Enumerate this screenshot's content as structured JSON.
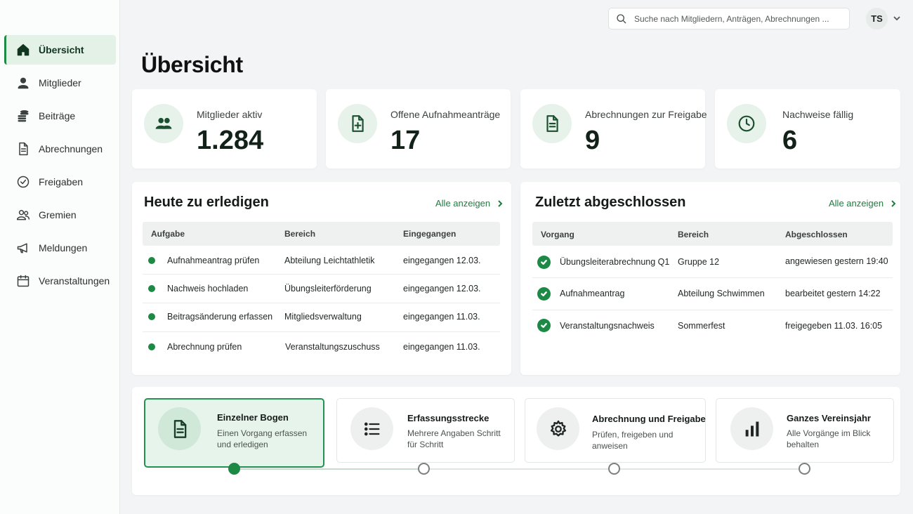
{
  "sidebar": {
    "items": [
      {
        "label": "Übersicht",
        "icon": "home-icon",
        "active": true
      },
      {
        "label": "Mitglieder",
        "icon": "person-icon"
      },
      {
        "label": "Beiträge",
        "icon": "coins-icon"
      },
      {
        "label": "Abrechnungen",
        "icon": "document-icon"
      },
      {
        "label": "Freigaben",
        "icon": "check-circle-icon"
      },
      {
        "label": "Gremien",
        "icon": "group-icon"
      },
      {
        "label": "Meldungen",
        "icon": "megaphone-icon"
      },
      {
        "label": "Veranstaltungen",
        "icon": "calendar-icon"
      }
    ]
  },
  "header": {
    "search_placeholder": "Suche nach Mitgliedern, Anträgen, Abrechnungen ...",
    "user_initials": "TS"
  },
  "page_title": "Übersicht",
  "stats": [
    {
      "label": "Mitglieder aktiv",
      "value": "1.284",
      "icon": "people-icon"
    },
    {
      "label": "Offene Aufnahmeanträge",
      "value": "17",
      "icon": "file-plus-icon"
    },
    {
      "label": "Abrechnungen zur Freigabe",
      "value": "9",
      "icon": "document-icon"
    },
    {
      "label": "Nachweise fällig",
      "value": "6",
      "icon": "clock-icon"
    }
  ],
  "todo": {
    "title": "Heute zu erledigen",
    "link": "Alle anzeigen",
    "columns": [
      "Aufgabe",
      "Bereich",
      "Eingegangen"
    ],
    "rows": [
      {
        "task": "Aufnahmeantrag prüfen",
        "area": "Abteilung Leichtathletik",
        "received": "eingegangen 12.03."
      },
      {
        "task": "Nachweis hochladen",
        "area": "Übungsleiterförderung",
        "received": "eingegangen 12.03."
      },
      {
        "task": "Beitragsänderung erfassen",
        "area": "Mitgliedsverwaltung",
        "received": "eingegangen 11.03."
      },
      {
        "task": "Abrechnung prüfen",
        "area": "Veranstaltungszuschuss",
        "received": "eingegangen 11.03."
      }
    ]
  },
  "done": {
    "title": "Zuletzt abgeschlossen",
    "link": "Alle anzeigen",
    "columns": [
      "Vorgang",
      "Bereich",
      "Abgeschlossen"
    ],
    "rows": [
      {
        "process": "Übungsleiterabrechnung Q1",
        "area": "Gruppe 12",
        "completed": "angewiesen gestern 19:40"
      },
      {
        "process": "Aufnahmeantrag",
        "area": "Abteilung Schwimmen",
        "completed": "bearbeitet gestern 14:22"
      },
      {
        "process": "Veranstaltungsnachweis",
        "area": "Sommerfest",
        "completed": "freigegeben 11.03. 16:05"
      }
    ]
  },
  "modes": {
    "selected_index": 0,
    "items": [
      {
        "title": "Einzelner Bogen",
        "description": "Einen Vorgang erfassen und erledigen",
        "icon": "document-icon"
      },
      {
        "title": "Erfassungsstrecke",
        "description": "Mehrere Angaben Schritt für Schritt",
        "icon": "list-icon"
      },
      {
        "title": "Abrechnung und Freigabe",
        "description": "Prüfen, freigeben und anweisen",
        "icon": "gear-icon"
      },
      {
        "title": "Ganzes Vereinsjahr",
        "description": "Alle Vorgänge im Blick behalten",
        "icon": "bar-chart-icon"
      }
    ]
  },
  "colors": {
    "accent": "#1c8a44",
    "accent_light": "#e3f1e7",
    "background": "#f2f4f5"
  }
}
